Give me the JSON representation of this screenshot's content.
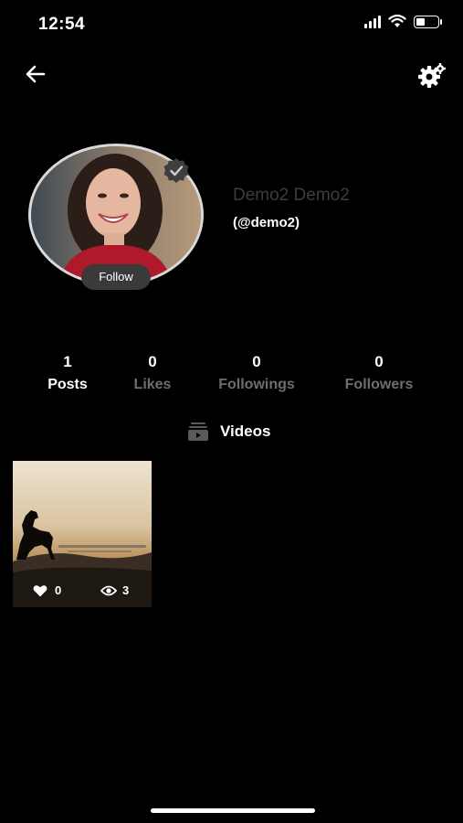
{
  "status_bar": {
    "time": "12:54"
  },
  "profile": {
    "name": "Demo2 Demo2",
    "handle": "(@demo2)",
    "follow_label": "Follow"
  },
  "stats": [
    {
      "value": "1",
      "label": "Posts"
    },
    {
      "value": "0",
      "label": "Likes"
    },
    {
      "value": "0",
      "label": "Followings"
    },
    {
      "value": "0",
      "label": "Followers"
    }
  ],
  "tabs": {
    "videos_label": "Videos"
  },
  "videos": [
    {
      "likes": "0",
      "views": "3"
    }
  ],
  "icons": {
    "back": "arrow-left-icon",
    "settings": "gear-icon",
    "verified": "verified-badge-icon",
    "videos": "video-library-icon",
    "likes": "heart-icon",
    "views": "eye-icon"
  }
}
